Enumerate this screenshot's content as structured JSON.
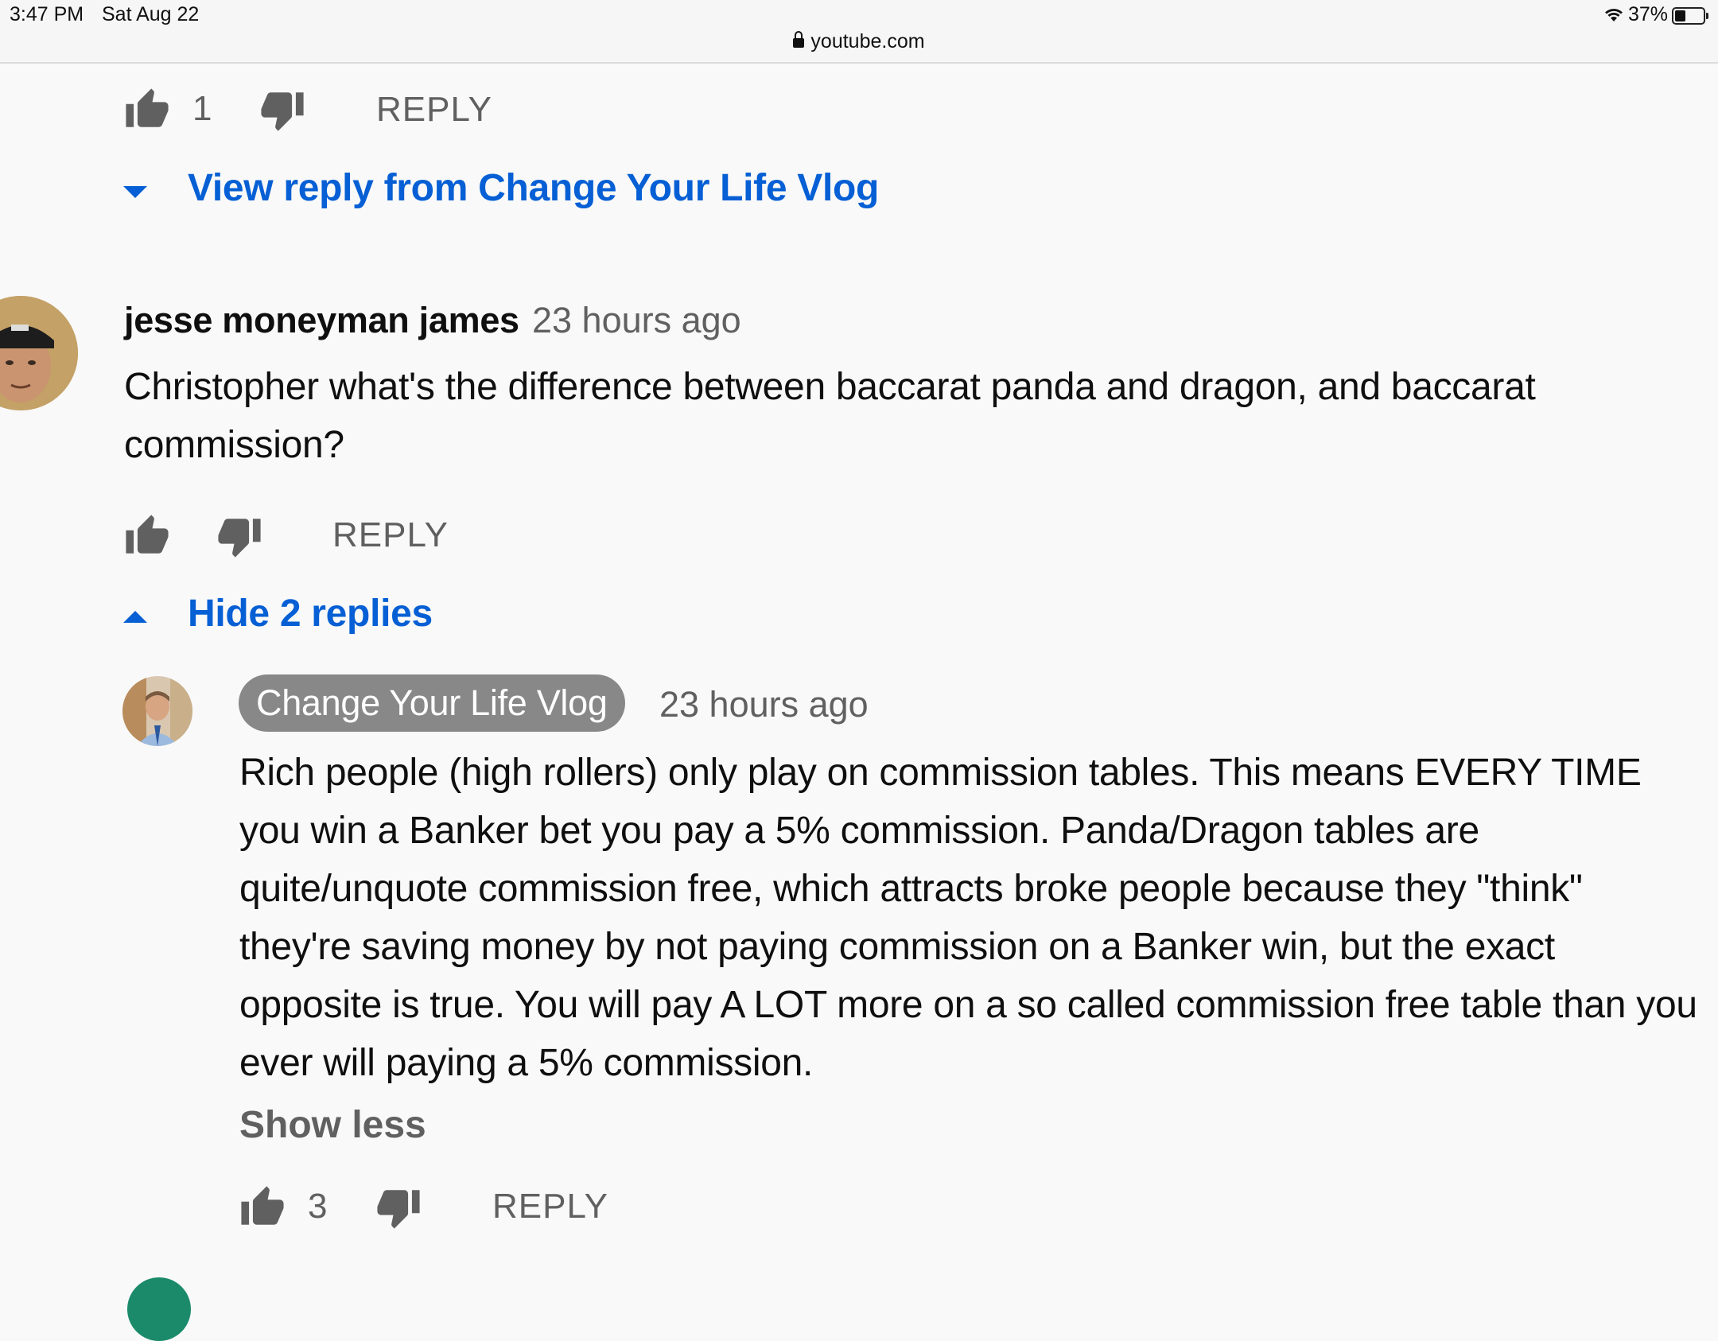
{
  "status_bar": {
    "time": "3:47 PM",
    "date": "Sat Aug 22",
    "url": "youtube.com",
    "battery": "37%",
    "battery_level": 0.37
  },
  "top_actions": {
    "like_count": "1",
    "reply_label": "REPLY"
  },
  "view_reply": {
    "label": "View reply from Change Your Life Vlog"
  },
  "comment": {
    "author": "jesse moneyman james",
    "timestamp": "23 hours ago",
    "text": "Christopher what's the difference between baccarat panda and dragon,  and baccarat commission?",
    "reply_label": "REPLY"
  },
  "hide_replies": {
    "label": "Hide 2 replies"
  },
  "reply": {
    "author": "Change Your Life Vlog",
    "timestamp": "23 hours ago",
    "text": "Rich people (high rollers) only play on commission tables. This means EVERY TIME you win a Banker bet you pay a 5% commission. Panda/Dragon tables are quite/unquote commission free, which attracts broke people because they \"think\" they're saving money by not paying commission on a Banker win, but the exact opposite is true. You will pay A LOT more on a so called commission free table than you ever will paying a 5% commission.",
    "show_less": "Show less",
    "like_count": "3",
    "reply_label": "REPLY"
  },
  "colors": {
    "link_blue": "#065fd4",
    "muted_gray": "#606060",
    "owner_badge": "#888888"
  }
}
